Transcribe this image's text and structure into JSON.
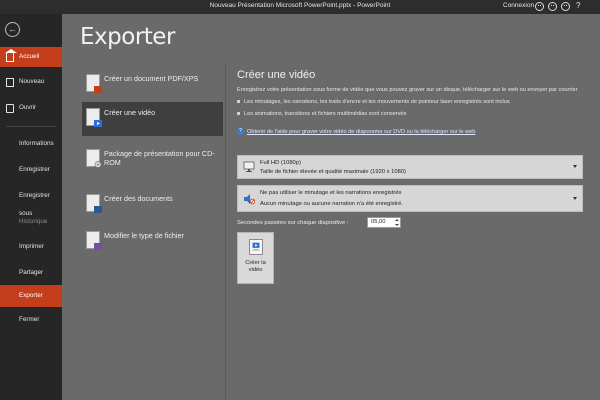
{
  "window": {
    "title": "Nouveau Présentation Microsoft PowerPoint.pptx  -  PowerPoint",
    "account": "Connexion",
    "help": "?"
  },
  "icons": {
    "back": "back-arrow-icon",
    "home": "home-icon",
    "new": "new-document-icon",
    "open": "folder-icon",
    "pdf": "pdf-document-icon",
    "video": "video-icon",
    "cdrom": "cd-package-icon",
    "handouts": "handouts-icon",
    "filetype": "file-type-icon",
    "quality": "monitor-icon",
    "timing": "timing-narration-icon",
    "help_circle": "help-circle-icon"
  },
  "colors": {
    "accent": "#c43e1c",
    "sidebar": "#262626",
    "titlebar": "#2d2d2d",
    "main_bg": "#6a6a6a"
  },
  "sidebar": {
    "back": "←",
    "top_items": [
      {
        "label": "Accueil"
      },
      {
        "label": "Nouveau"
      },
      {
        "label": "Ouvrir"
      }
    ],
    "items": [
      {
        "label": "Informations"
      },
      {
        "label": "Enregistrer"
      },
      {
        "label": "Enregistrer sous"
      },
      {
        "label": "Historique"
      },
      {
        "label": "Imprimer"
      },
      {
        "label": "Partager"
      },
      {
        "label": "Exporter"
      },
      {
        "label": "Fermer"
      }
    ],
    "active": "Exporter"
  },
  "main": {
    "title": "Exporter",
    "options": [
      {
        "label": "Créer un document PDF/XPS"
      },
      {
        "label": "Créer une vidéo"
      },
      {
        "label": "Package de présentation pour CD-ROM"
      },
      {
        "label": "Créer des documents"
      },
      {
        "label": "Modifier le type de fichier"
      }
    ],
    "selected": "Créer une vidéo"
  },
  "video": {
    "heading": "Créer une vidéo",
    "description": "Enregistrez votre présentation sous forme de vidéo que vous pouvez graver sur un disque, télécharger sur le web ou envoyer par courrier",
    "bullets": [
      "Les minutages, les narrations, les traits d'encre et les mouvements de pointeur laser enregistrés sont inclus",
      "Les animations, transitions et fichiers multimédias sont conservés"
    ],
    "help_link": "Obtenir de l'aide pour graver votre vidéo de diaporama sur DVD ou la télécharger sur le web",
    "quality": {
      "title": "Full HD (1080p)",
      "subtitle": "Taille de fichier élevée et qualité maximale (1920 x 1080)"
    },
    "timing": {
      "title": "Ne pas utiliser le minutage et les narrations enregistrés",
      "subtitle": "Aucun minutage ou aucune narration n'a été enregistré."
    },
    "seconds_label": "Secondes passées sur chaque diapositive :",
    "seconds_value": "05,00",
    "create_button": {
      "line1": "Créer la",
      "line2": "vidéo"
    }
  }
}
